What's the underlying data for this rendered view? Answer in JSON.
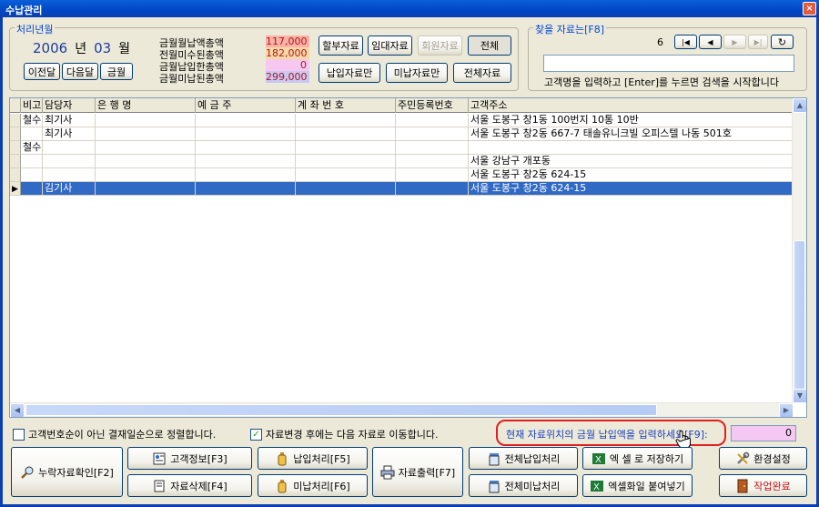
{
  "window": {
    "title": "수납관리",
    "close": "×"
  },
  "period": {
    "legend": "처리년월",
    "year": "2006",
    "year_unit": "년",
    "month": "03",
    "month_unit": "월",
    "prev_month": "이전달",
    "next_month": "다음달",
    "this_month": "금월"
  },
  "summary": [
    {
      "label": "금월월납액총액",
      "value": "117,000",
      "color": "#F9B3A6"
    },
    {
      "label": "전월미수된총액",
      "value": "182,000",
      "color": "#F6D9A4"
    },
    {
      "label": "금월납입한총액",
      "value": "0",
      "color": "#F6C8F0"
    },
    {
      "label": "금월미납된총액",
      "value": "299,000",
      "color": "#C9C8F2"
    }
  ],
  "filters": {
    "installment": "할부자료",
    "rental": "임대자료",
    "member": "회원자료",
    "all": "전체",
    "paid_only": "납입자료만",
    "unpaid_only": "미납자료만",
    "all_data": "전체자료"
  },
  "search": {
    "legend": "찾을 자료는[F8]",
    "record_no": "6",
    "hint": "고객명을 입력하고 [Enter]를 누르면 검색을 시작합니다",
    "value": ""
  },
  "grid": {
    "columns": [
      "비고",
      "담당자",
      "은 행 명",
      "예 금 주",
      "계 좌 번 호",
      "주민등록번호",
      "고객주소"
    ],
    "rows": [
      {
        "note": "철수",
        "manager": "최기사",
        "bank": "",
        "holder": "",
        "account": "",
        "rrn": "",
        "address": "서울 도봉구 창1동 100번지 10통 10반"
      },
      {
        "note": "",
        "manager": "최기사",
        "bank": "",
        "holder": "",
        "account": "",
        "rrn": "",
        "address": "서울 도봉구 창2동 667-7 태솔유니크빌 오피스텔 나동 501호"
      },
      {
        "note": "철수",
        "manager": "",
        "bank": "",
        "holder": "",
        "account": "",
        "rrn": "",
        "address": ""
      },
      {
        "note": "",
        "manager": "",
        "bank": "",
        "holder": "",
        "account": "",
        "rrn": "",
        "address": "서울 강남구 개포동"
      },
      {
        "note": "",
        "manager": "",
        "bank": "",
        "holder": "",
        "account": "",
        "rrn": "",
        "address": "서울 도봉구 창2동 624-15"
      },
      {
        "note": "",
        "manager": "김기사",
        "bank": "",
        "holder": "",
        "account": "",
        "rrn": "",
        "address": "서울 도봉구 창2동 624-15"
      }
    ]
  },
  "options": {
    "sort_by_payment_day": "고객번호순이 아닌 결재일순으로 정렬합니다.",
    "move_next_after_change": "자료변경 후에는 다음 자료로 이동합니다.",
    "amount_prompt": "현재 자료위치의 금월 납입액을 입력하세요[F9]:",
    "amount_value": "0"
  },
  "actions": {
    "missing_check": "누락자료확인[F2]",
    "customer_info": "고객정보[F3]",
    "delete_data": "자료삭제[F4]",
    "pay": "납입처리[F5]",
    "unpay": "미납처리[F6]",
    "print": "자료출력[F7]",
    "pay_all": "전체납입처리",
    "unpay_all": "전체미납처리",
    "excel_save": "엑 셀 로 저장하기",
    "excel_paste": "엑셀화일 붙여넣기",
    "settings": "환경설정",
    "done": "작업완료"
  }
}
